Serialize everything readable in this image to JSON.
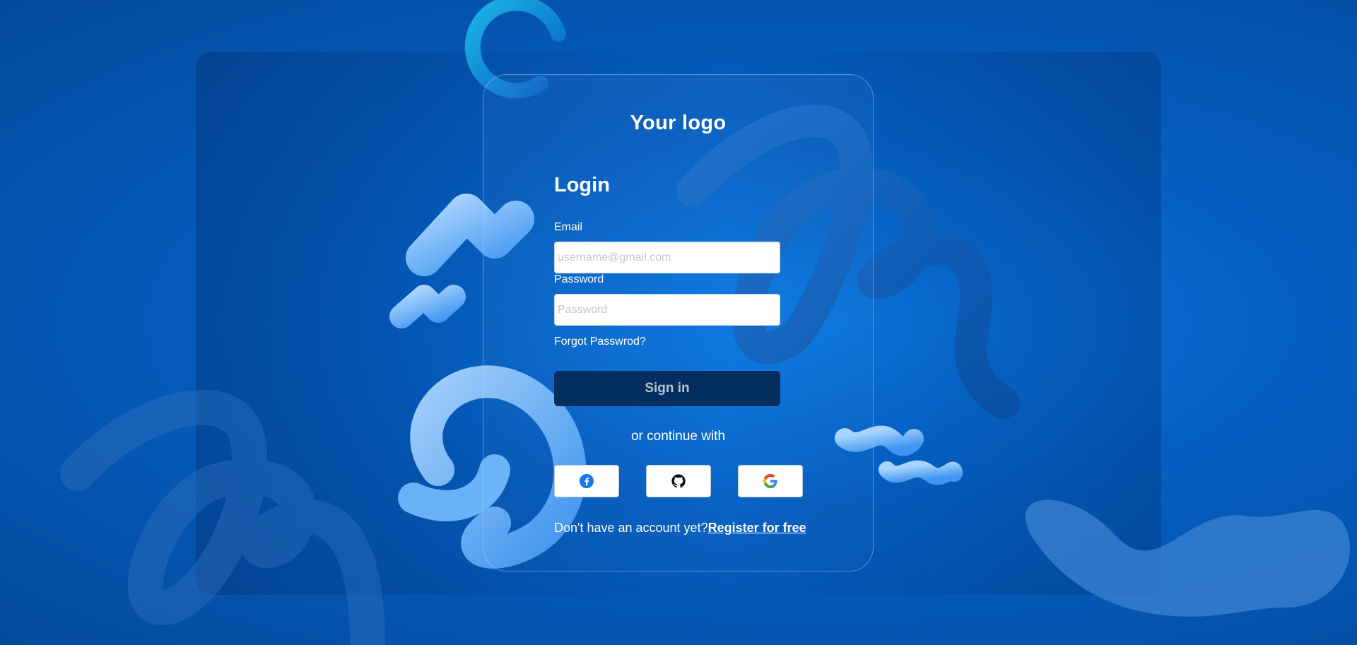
{
  "brand": {
    "logo_text": "Your logo"
  },
  "login": {
    "title": "Login",
    "email_label": "Email",
    "email_placeholder": "username@gmail.com",
    "email_value": "",
    "password_label": "Password",
    "password_placeholder": "Password",
    "password_value": "",
    "forgot_label": "Forgot Passwrod?",
    "signin_label": "Sign in",
    "continue_label": "or continue with",
    "social": [
      {
        "icon": "facebook-icon"
      },
      {
        "icon": "github-icon"
      },
      {
        "icon": "google-icon"
      }
    ],
    "no_account_text": "Don't have an account yet?",
    "register_label": "Register for free"
  },
  "colors": {
    "background": "#0560c4",
    "signin_button": "#032e5f",
    "facebook": "#1877f2"
  }
}
